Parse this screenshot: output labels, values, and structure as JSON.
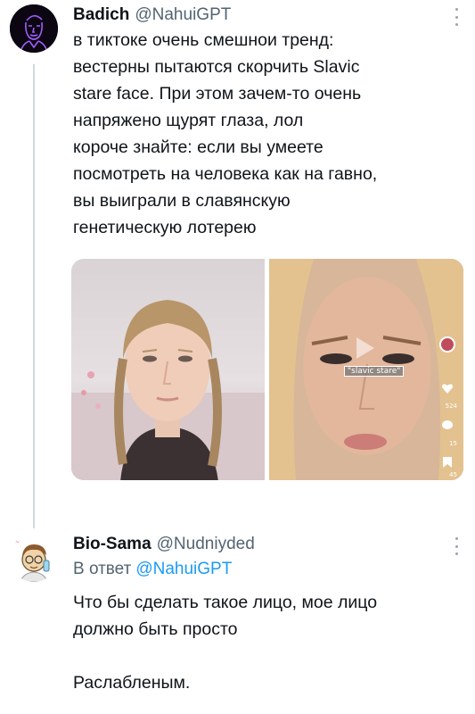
{
  "tweets": [
    {
      "author_name": "Badich",
      "author_handle": "@NahuiGPT",
      "avatar_icon": "neon-portrait-avatar",
      "text": "в тиктоке очень смешнои тренд:\nвестерны пытаются скорчить Slavic\nstare face. При этом зачем-то очень\nнапряжено щурят глаза, лол\nкороче знайте: если вы умеете\nпосмотреть на человека как на гавно,\nвы выиграли в славянскую\nгенетическую лотерею",
      "media": {
        "left_photo": "girl-with-braids-photo",
        "right_photo": "tiktok-screenshot-photo",
        "tiktok_badge": "\"slavic stare\"",
        "like_count": "524",
        "comment_count": "15",
        "bookmark_count": "45"
      }
    },
    {
      "author_name": "Bio-Sama",
      "author_handle": "@Nudniyded",
      "avatar_icon": "cartoon-scientist-avatar",
      "reply_to_prefix": "В ответ",
      "reply_to_handle": "@NahuiGPT",
      "text": "Что бы сделать такое лицо, мое лицо\nдолжно быть просто\n\nРаслабленым."
    }
  ],
  "colors": {
    "text_primary": "#0f1419",
    "text_secondary": "#536471",
    "link": "#1d9bf0",
    "thread_line": "#cfd9de"
  },
  "icons": [
    "more-options-icon",
    "tiktok-heart-icon",
    "tiktok-comment-icon",
    "tiktok-bookmark-icon"
  ]
}
